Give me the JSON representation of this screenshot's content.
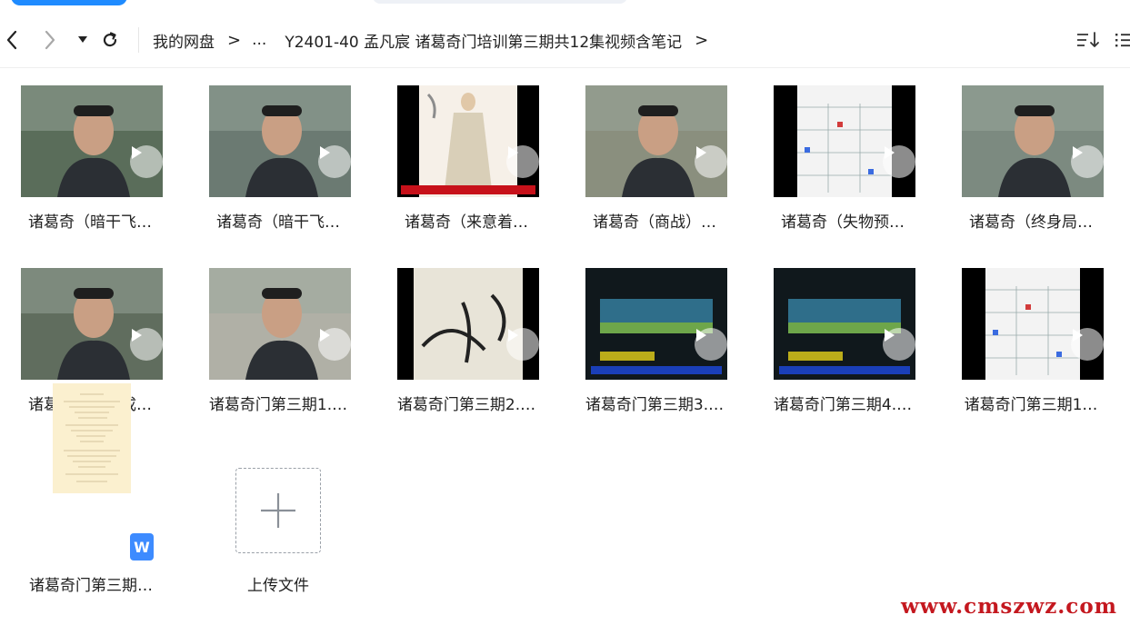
{
  "toolbar": {
    "breadcrumb": [
      {
        "label": "我的网盘"
      },
      {
        "label": "..."
      },
      {
        "label": "Y2401-40 孟凡宸 诸葛奇门培训第三期共12集视频含笔记"
      }
    ]
  },
  "files": [
    {
      "name": "诸葛奇（暗干飞…",
      "thumb_kind": "person",
      "thumb_color": "#5a6d5a"
    },
    {
      "name": "诸葛奇（暗干飞…",
      "thumb_kind": "person",
      "thumb_color": "#6b7a72"
    },
    {
      "name": "诸葛奇（来意着…",
      "thumb_kind": "illustration",
      "thumb_color": "#f6f0e8"
    },
    {
      "name": "诸葛奇（商战）…",
      "thumb_kind": "person",
      "thumb_color": "#8a8f7e"
    },
    {
      "name": "诸葛奇（失物预…",
      "thumb_kind": "chart",
      "thumb_color": "#f3f3f3"
    },
    {
      "name": "诸葛奇（终身局…",
      "thumb_kind": "person",
      "thumb_color": "#7c8a80"
    },
    {
      "name": "诸葛奇门第《成…",
      "thumb_kind": "person",
      "thumb_color": "#606d5e"
    },
    {
      "name": "诸葛奇门第三期1.…",
      "thumb_kind": "person",
      "thumb_color": "#b0b0a6"
    },
    {
      "name": "诸葛奇门第三期2.…",
      "thumb_kind": "calligraphy",
      "thumb_color": "#e8e4d8"
    },
    {
      "name": "诸葛奇门第三期3.…",
      "thumb_kind": "banner",
      "thumb_color": "#10181c"
    },
    {
      "name": "诸葛奇门第三期4.…",
      "thumb_kind": "banner",
      "thumb_color": "#10181c"
    },
    {
      "name": "诸葛奇门第三期1…",
      "thumb_kind": "chart",
      "thumb_color": "#f3f3f3"
    }
  ],
  "document": {
    "name": "诸葛奇门第三期…",
    "badge": "W"
  },
  "upload": {
    "label": "上传文件"
  },
  "watermark": {
    "text": "www.cmszwz.com"
  },
  "colors": {
    "accent": "#1f8bff",
    "doc_badge": "#3d8bff",
    "watermark": "#c4181f"
  }
}
